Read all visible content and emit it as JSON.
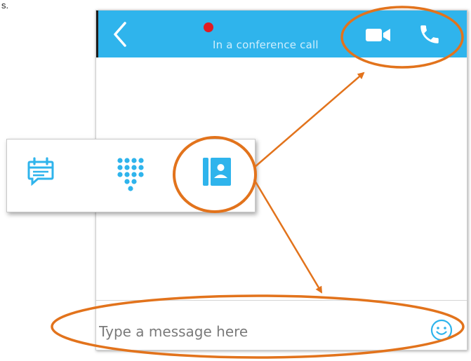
{
  "header": {
    "status_text": "In a conference call"
  },
  "message": {
    "placeholder": "Type a message here"
  },
  "stray_text": "s.",
  "icons": {
    "back": "chevron-left-icon",
    "status": "status-dot-icon",
    "video": "video-camera-icon",
    "call": "phone-icon",
    "emoji": "smiley-icon",
    "meeting": "meeting-chat-icon",
    "dialpad": "dialpad-icon",
    "contacts": "contacts-book-icon"
  },
  "colors": {
    "header_bg": "#2fb4ec",
    "icon_blue": "#2fb4ec",
    "status_red": "#e11b22",
    "annotation_orange": "#e2731c"
  }
}
